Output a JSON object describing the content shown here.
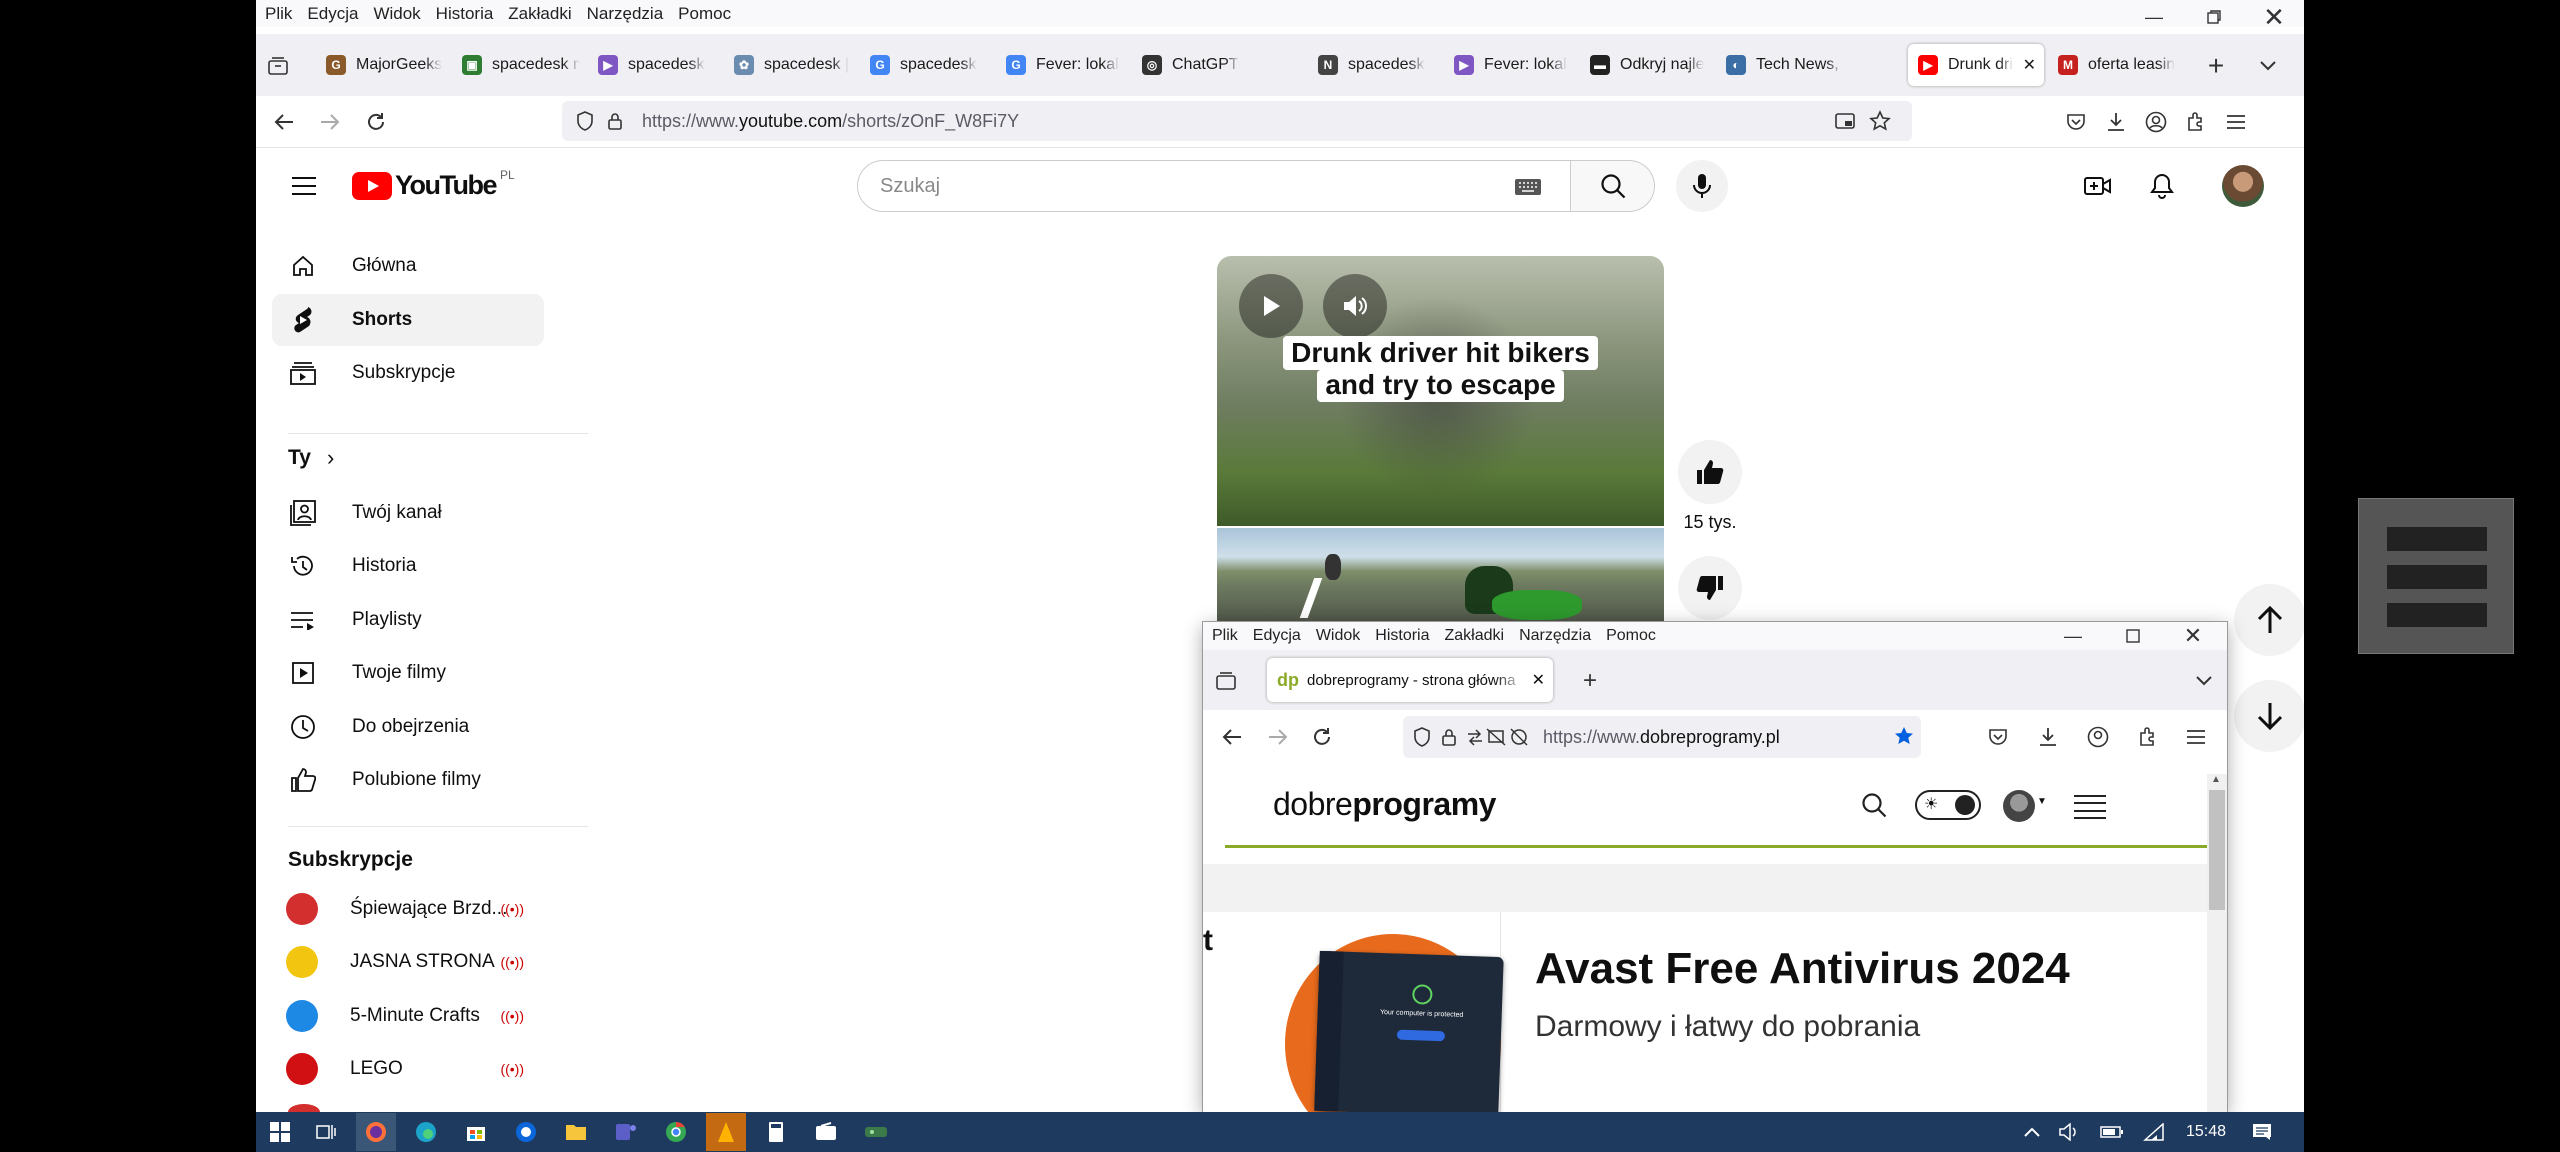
{
  "browser": {
    "menu": [
      "Plik",
      "Edycja",
      "Widok",
      "Historia",
      "Zakładki",
      "Narzędzia",
      "Pomoc"
    ],
    "tabs": [
      {
        "label": "MajorGeeks",
        "color": "#8b5a2b",
        "glyph": "G"
      },
      {
        "label": "spacedesk n",
        "color": "#2e7d32",
        "glyph": "▣"
      },
      {
        "label": "spacedesk",
        "color": "#7e57c2",
        "glyph": "▶"
      },
      {
        "label": "spacedesk |",
        "color": "#6a8caf",
        "glyph": "✿"
      },
      {
        "label": "spacedesk",
        "color": "#4285f4",
        "glyph": "G"
      },
      {
        "label": "Fever: lokal",
        "color": "#4285f4",
        "glyph": "G"
      },
      {
        "label": "ChatGPT",
        "color": "#333333",
        "glyph": "◎"
      },
      {
        "label": "spacedesk",
        "color": "#444444",
        "glyph": "N"
      },
      {
        "label": "Fever: lokal",
        "color": "#7e57c2",
        "glyph": "▶"
      },
      {
        "label": "Odkryj najle",
        "color": "#222222",
        "glyph": "▬"
      },
      {
        "label": "Tech News, I",
        "color": "#3a6ea5",
        "glyph": "◐"
      },
      {
        "label": "Drunk dri",
        "color": "#ff0000",
        "glyph": "▶"
      },
      {
        "label": "oferta leasin",
        "color": "#c5221f",
        "glyph": "M"
      }
    ],
    "url_prefix": "https://www.",
    "url_domain": "youtube.com",
    "url_path": "/shorts/zOnF_W8Fi7Y"
  },
  "youtube": {
    "logo_text": "YouTube",
    "country": "PL",
    "search_placeholder": "Szukaj",
    "nav": [
      {
        "label": "Główna",
        "icon": "home-icon"
      },
      {
        "label": "Shorts",
        "icon": "shorts-icon"
      },
      {
        "label": "Subskrypcje",
        "icon": "subscriptions-icon"
      }
    ],
    "you_header": "Ty",
    "you_items": [
      {
        "label": "Twój kanał",
        "icon": "channel-icon"
      },
      {
        "label": "Historia",
        "icon": "history-icon"
      },
      {
        "label": "Playlisty",
        "icon": "playlist-icon"
      },
      {
        "label": "Twoje filmy",
        "icon": "video-icon"
      },
      {
        "label": "Do obejrzenia",
        "icon": "watch-later-icon"
      },
      {
        "label": "Polubione filmy",
        "icon": "like-icon"
      }
    ],
    "subs_header": "Subskrypcje",
    "subs": [
      {
        "label": "Śpiewające Brzd...",
        "color": "#d32f2f"
      },
      {
        "label": "JASNA STRONA",
        "color": "#f2c511"
      },
      {
        "label": "5-Minute Crafts",
        "color": "#1e88e5"
      },
      {
        "label": "LEGO",
        "color": "#d01012"
      }
    ],
    "short_caption_line1": "Drunk driver hit bikers",
    "short_caption_line2": "and try to escape",
    "likes": "15 tys."
  },
  "popup": {
    "menu": [
      "Plik",
      "Edycja",
      "Widok",
      "Historia",
      "Zakładki",
      "Narzędzia",
      "Pomoc"
    ],
    "tab_label": "dobreprogramy - strona główna",
    "tab_favicon": "dp",
    "url_prefix": "https://www.",
    "url_domain": "dobreprogramy.pl",
    "logo_plain": "dobre",
    "logo_bold": "programy",
    "headline": "Avast Free Antivirus 2024",
    "subheadline": "Darmowy i łatwy do pobrania",
    "edge_letter": "t",
    "thumb_text": "Your computer is protected"
  },
  "taskbar": {
    "time": "15:48"
  },
  "colors": {
    "yt_red": "#ff0000",
    "dp_green": "#8bab28",
    "taskbar": "#1f3a5f"
  }
}
